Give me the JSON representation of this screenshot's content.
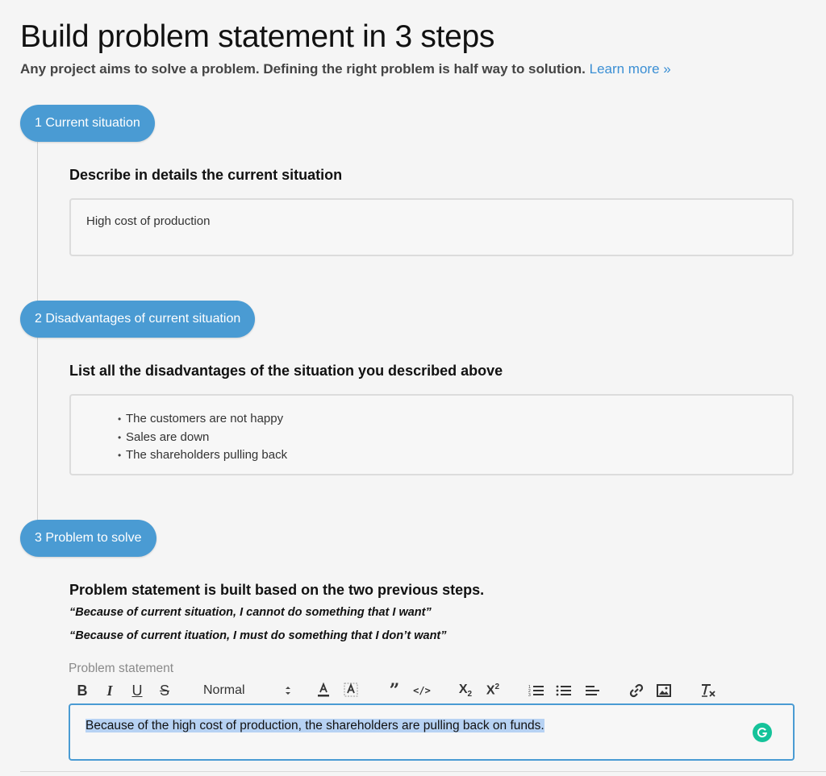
{
  "header": {
    "title": "Build problem statement in 3 steps",
    "subtitle": "Any project aims to solve a problem. Defining the right problem is half way to solution.",
    "learn_more": "Learn more »"
  },
  "steps": [
    {
      "label": "1 Current situation",
      "heading": "Describe in details the current situation",
      "value": "High cost of production"
    },
    {
      "label": "2 Disadvantages of current situation",
      "heading": "List all the disadvantages of the situation you described above",
      "items": [
        "The customers are not happy",
        "Sales are down",
        "The shareholders pulling back"
      ]
    },
    {
      "label": "3 Problem to solve",
      "heading": "Problem statement is built based on the two previous steps.",
      "quotes": [
        "“Because of current situation, I cannot do something that I want”",
        "“Because of current ituation, I must do something that I don’t want”"
      ],
      "field_label": "Problem statement",
      "editor_text": "Because of the high cost of production, the shareholders are pulling back on funds."
    }
  ],
  "toolbar": {
    "format_select": "Normal",
    "icons": [
      "bold-icon",
      "italic-icon",
      "underline-icon",
      "strike-icon",
      "font-color-icon",
      "highlight-icon",
      "blockquote-icon",
      "code-icon",
      "subscript-icon",
      "superscript-icon",
      "ordered-list-icon",
      "bullet-list-icon",
      "align-icon",
      "link-icon",
      "image-icon",
      "clear-format-icon"
    ]
  },
  "colors": {
    "accent": "#4a9bd3",
    "link": "#3b8fd4",
    "selection": "#b7d2f3",
    "grammarly": "#15c39a"
  }
}
